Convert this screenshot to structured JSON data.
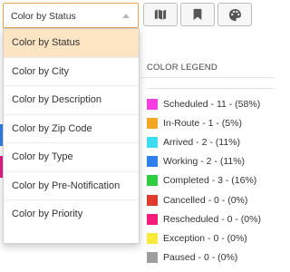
{
  "toolbar": {
    "color_select": {
      "value": "Color by Status"
    },
    "buttons": [
      {
        "name": "map-icon"
      },
      {
        "name": "bookmark-icon"
      },
      {
        "name": "palette-icon"
      }
    ]
  },
  "dropdown": {
    "options": [
      {
        "label": "Color by Status",
        "selected": true
      },
      {
        "label": "Color by City",
        "selected": false
      },
      {
        "label": "Color by Description",
        "selected": false
      },
      {
        "label": "Color by Zip Code",
        "selected": false
      },
      {
        "label": "Color by Type",
        "selected": false
      },
      {
        "label": "Color by Pre-Notification",
        "selected": false
      },
      {
        "label": "Color by Priority",
        "selected": false
      }
    ]
  },
  "legend": {
    "header": "COLOR LEGEND",
    "items": [
      {
        "label": "Scheduled - 11 - (58%)",
        "color": "#f53ee0"
      },
      {
        "label": "In-Route - 1 - (5%)",
        "color": "#f5a623"
      },
      {
        "label": "Arrived - 2 - (11%)",
        "color": "#3ddcf2"
      },
      {
        "label": "Working - 2 - (11%)",
        "color": "#2f80ed"
      },
      {
        "label": "Completed - 3 - (16%)",
        "color": "#2ecc40"
      },
      {
        "label": "Cancelled - 0 - (0%)",
        "color": "#e03a2f"
      },
      {
        "label": "Rescheduled - 0 - (0%)",
        "color": "#f21d7a"
      },
      {
        "label": "Exception - 0 - (0%)",
        "color": "#f7ea3a"
      },
      {
        "label": "Paused - 0 - (0%)",
        "color": "#9e9e9e"
      }
    ]
  },
  "colors": {
    "accent_border": "#e6a24f",
    "selected_bg": "#fde4c3"
  }
}
